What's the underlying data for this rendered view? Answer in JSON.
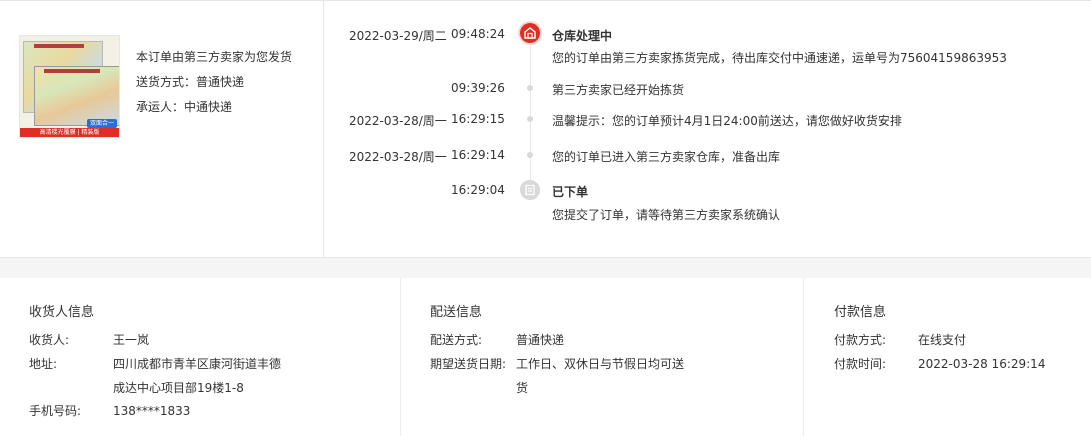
{
  "product": {
    "thumb_badge": "双面合一",
    "thumb_banner": "高清楼光覆膜 | 精装版"
  },
  "shipping_summary": {
    "seller_note": "本订单由第三方卖家为您发货",
    "method": "送货方式：普通快递",
    "carrier": "承运人：中通快递"
  },
  "timeline": [
    {
      "date": "2022-03-29/周二",
      "time": "09:48:24",
      "title": "仓库处理中",
      "desc": "您的订单由第三方卖家拣货完成，待出库交付中通速递，运单号为75604159863953",
      "icon": "warehouse-icon",
      "state": "active"
    },
    {
      "date": "",
      "time": "09:39:26",
      "title": "",
      "desc": "第三方卖家已经开始拣货",
      "state": "normal"
    },
    {
      "date": "2022-03-28/周一",
      "time": "16:29:15",
      "title": "",
      "desc": "温馨提示：您的订单预计4月1日24:00前送达，请您做好收货安排",
      "state": "normal"
    },
    {
      "date": "2022-03-28/周一",
      "time": "16:29:14",
      "title": "",
      "desc": "您的订单已进入第三方卖家仓库，准备出库",
      "state": "normal"
    },
    {
      "date": "",
      "time": "16:29:04",
      "title": "已下单",
      "desc": "您提交了订单，请等待第三方卖家系统确认",
      "icon": "order-placed-icon",
      "state": "done"
    }
  ],
  "receiver": {
    "title": "收货人信息",
    "name_label": "收货人:",
    "name_value": "王一岚",
    "address_label": "地址:",
    "address_line1": "四川成都市青羊区康河街道丰德",
    "address_line2": "成达中心项目部19楼1-8",
    "phone_label": "手机号码:",
    "phone_value": "138****1833"
  },
  "delivery": {
    "title": "配送信息",
    "method_label": "配送方式:",
    "method_value": "普通快递",
    "expected_label": "期望送货日期:",
    "expected_line1": "工作日、双休日与节假日均可送",
    "expected_line2": "货"
  },
  "payment": {
    "title": "付款信息",
    "method_label": "付款方式:",
    "method_value": "在线支付",
    "time_label": "付款时间:",
    "time_value": "2022-03-28 16:29:14"
  },
  "colors": {
    "accent": "#e02e24",
    "line": "#e6e6e6",
    "text": "#333333",
    "gap": "#f5f5f5"
  }
}
